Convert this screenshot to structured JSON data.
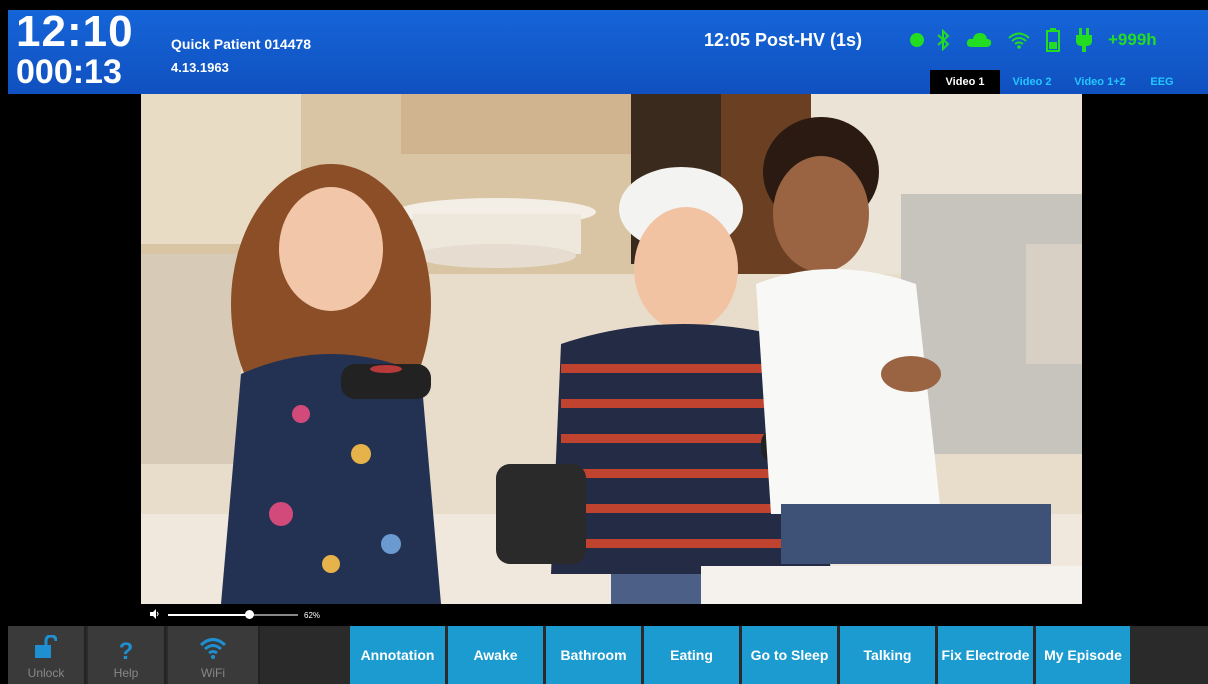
{
  "header": {
    "clock": "12:10",
    "elapsed": "000:13",
    "patient_name": "Quick Patient 014478",
    "patient_dob": "4.13.1963",
    "event": "12:05 Post-HV (1s)",
    "battery_hours": "+999h",
    "status_icons": [
      "status-dot-icon",
      "bluetooth-icon",
      "cloud-icon",
      "wifi-icon",
      "battery-icon",
      "power-plug-icon"
    ],
    "status_color": "#22dd22"
  },
  "video_tabs": [
    {
      "label": "Video 1",
      "active": true
    },
    {
      "label": "Video 2",
      "active": false
    },
    {
      "label": "Video 1+2",
      "active": false
    },
    {
      "label": "EEG",
      "active": false
    }
  ],
  "video": {
    "volume_percent": 62,
    "volume_label": "62%"
  },
  "utility_buttons": [
    {
      "label": "Unlock",
      "icon": "unlock-icon"
    },
    {
      "label": "Help",
      "icon": "help-icon"
    },
    {
      "label": "WiFi",
      "icon": "wifi-icon"
    }
  ],
  "action_buttons": [
    "Annotation",
    "Awake",
    "Bathroom",
    "Eating",
    "Go to Sleep",
    "Talking",
    "Fix Electrode",
    "My Episode"
  ],
  "colors": {
    "header_blue": "#1565d8",
    "action_blue": "#1c9bd0",
    "tab_cyan": "#22c8ff",
    "icon_blue": "#1e8fd0"
  }
}
